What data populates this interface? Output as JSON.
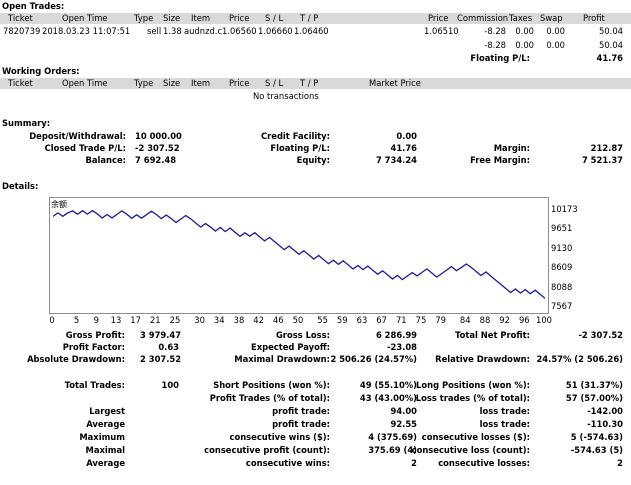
{
  "open_trades": {
    "title": "Open Trades:",
    "headers": [
      "Ticket",
      "Open Time",
      "Type",
      "Size",
      "Item",
      "Price",
      "S / L",
      "T / P",
      "Price",
      "Commission",
      "Taxes",
      "Swap",
      "Profit"
    ],
    "row": {
      "ticket": "7820739",
      "open_time": "2018.03.23 11:07:51",
      "type": "sell",
      "size": "1.38",
      "item": "audnzd.c",
      "price": "1.06560",
      "sl": "1.06660",
      "tp": "1.06460",
      "cur_price": "1.06510",
      "commission": "-8.28",
      "taxes": "0.00",
      "swap": "0.00",
      "profit": "50.04"
    },
    "subtotal": {
      "commission": "-8.28",
      "taxes": "0.00",
      "swap": "0.00",
      "profit": "50.04"
    },
    "floating_label": "Floating P/L:",
    "floating_value": "41.76"
  },
  "working_orders": {
    "title": "Working Orders:",
    "headers": [
      "Ticket",
      "Open Time",
      "Type",
      "Size",
      "Item",
      "Price",
      "S / L",
      "T / P",
      "Market Price"
    ],
    "empty_text": "No transactions"
  },
  "summary": {
    "title": "Summary:",
    "deposit_label": "Deposit/Withdrawal:",
    "deposit_value": "10 000.00",
    "credit_label": "Credit Facility:",
    "credit_value": "0.00",
    "closed_label": "Closed Trade P/L:",
    "closed_value": "-2 307.52",
    "floating_label": "Floating P/L:",
    "floating_value": "41.76",
    "margin_label": "Margin:",
    "margin_value": "212.87",
    "balance_label": "Balance:",
    "balance_value": "7 692.48",
    "equity_label": "Equity:",
    "equity_value": "7 734.24",
    "free_margin_label": "Free Margin:",
    "free_margin_value": "7 521.37"
  },
  "details": {
    "title": "Details:",
    "gross_profit_label": "Gross Profit:",
    "gross_profit": "3 979.47",
    "gross_loss_label": "Gross Loss:",
    "gross_loss": "6 286.99",
    "total_net_label": "Total Net Profit:",
    "total_net": "-2 307.52",
    "profit_factor_label": "Profit Factor:",
    "profit_factor": "0.63",
    "expected_payoff_label": "Expected Payoff:",
    "expected_payoff": "-23.08",
    "abs_dd_label": "Absolute Drawdown:",
    "abs_dd": "2 307.52",
    "max_dd_label": "Maximal Drawdown:",
    "max_dd": "2 506.26 (24.57%)",
    "rel_dd_label": "Relative Drawdown:",
    "rel_dd": "24.57% (2 506.26)",
    "total_trades_label": "Total Trades:",
    "total_trades": "100",
    "short_label": "Short Positions (won %):",
    "short_value": "49 (55.10%)",
    "long_label": "Long Positions (won %):",
    "long_value": "51 (31.37%)",
    "profit_trades_label": "Profit Trades (% of total):",
    "profit_trades": "43 (43.00%)",
    "loss_trades_label": "Loss trades (% of total):",
    "loss_trades": "57 (57.00%)",
    "largest_label": "Largest",
    "largest_profit_label": "profit trade:",
    "largest_profit": "94.00",
    "largest_loss_label": "loss trade:",
    "largest_loss": "-142.00",
    "average_label": "Average",
    "avg_profit_label": "profit trade:",
    "avg_profit": "92.55",
    "avg_loss_label": "loss trade:",
    "avg_loss": "-110.30",
    "maximum_label": "Maximum",
    "cons_wins_usd_label": "consecutive wins ($):",
    "cons_wins_usd": "4 (375.69)",
    "cons_losses_usd_label": "consecutive losses ($):",
    "cons_losses_usd": "5 (-574.63)",
    "maximal_label": "Maximal",
    "cons_profit_label": "consecutive profit (count):",
    "cons_profit": "375.69 (4)",
    "cons_loss_label": "consecutive loss (count):",
    "cons_loss": "-574.63 (5)",
    "average2_label": "Average",
    "avg_cons_wins_label": "consecutive wins:",
    "avg_cons_wins": "2",
    "avg_cons_losses_label": "consecutive losses:",
    "avg_cons_losses": "2"
  },
  "chart_data": {
    "type": "line",
    "title": "",
    "corner_label": "余额",
    "line_color": "#1c1c9c",
    "x_ticks": [
      0,
      5,
      9,
      13,
      17,
      21,
      25,
      30,
      34,
      38,
      42,
      46,
      50,
      55,
      59,
      63,
      67,
      71,
      75,
      79,
      84,
      88,
      92,
      96,
      100
    ],
    "y_ticks": [
      10173,
      9651,
      9130,
      8609,
      8088,
      7567
    ],
    "ylim": [
      7567,
      10173
    ],
    "xlim": [
      0,
      100
    ],
    "x": [
      0,
      1,
      2,
      3,
      4,
      5,
      6,
      7,
      8,
      9,
      10,
      11,
      12,
      13,
      14,
      15,
      16,
      17,
      18,
      19,
      20,
      21,
      22,
      23,
      24,
      25,
      26,
      27,
      28,
      29,
      30,
      31,
      32,
      33,
      34,
      35,
      36,
      37,
      38,
      39,
      40,
      41,
      42,
      43,
      44,
      45,
      46,
      47,
      48,
      49,
      50,
      51,
      52,
      53,
      54,
      55,
      56,
      57,
      58,
      59,
      60,
      61,
      62,
      63,
      64,
      65,
      66,
      67,
      68,
      69,
      70,
      71,
      72,
      73,
      74,
      75,
      76,
      77,
      78,
      79,
      80,
      81,
      82,
      83,
      84,
      85,
      86,
      87,
      88,
      89,
      90,
      91,
      92,
      93,
      94,
      95,
      96,
      97,
      98,
      99,
      100
    ],
    "y": [
      10000,
      10094,
      10004,
      10098,
      10150,
      10060,
      10154,
      10064,
      10158,
      10068,
      9958,
      10052,
      9962,
      10056,
      10150,
      10060,
      9950,
      10044,
      9954,
      10048,
      10142,
      10052,
      9942,
      10036,
      9946,
      9836,
      9930,
      10024,
      9934,
      9824,
      9714,
      9808,
      9718,
      9608,
      9702,
      9592,
      9686,
      9576,
      9466,
      9560,
      9470,
      9564,
      9454,
      9344,
      9438,
      9328,
      9218,
      9108,
      9202,
      9092,
      8982,
      9076,
      8966,
      8856,
      8950,
      8840,
      8730,
      8824,
      8714,
      8808,
      8698,
      8588,
      8682,
      8572,
      8666,
      8556,
      8446,
      8540,
      8430,
      8320,
      8414,
      8304,
      8398,
      8492,
      8402,
      8496,
      8590,
      8480,
      8370,
      8464,
      8558,
      8652,
      8542,
      8632,
      8722,
      8632,
      8522,
      8412,
      8506,
      8396,
      8286,
      8176,
      8066,
      7956,
      8050,
      7940,
      8034,
      7924,
      8018,
      7908,
      7800
    ]
  }
}
